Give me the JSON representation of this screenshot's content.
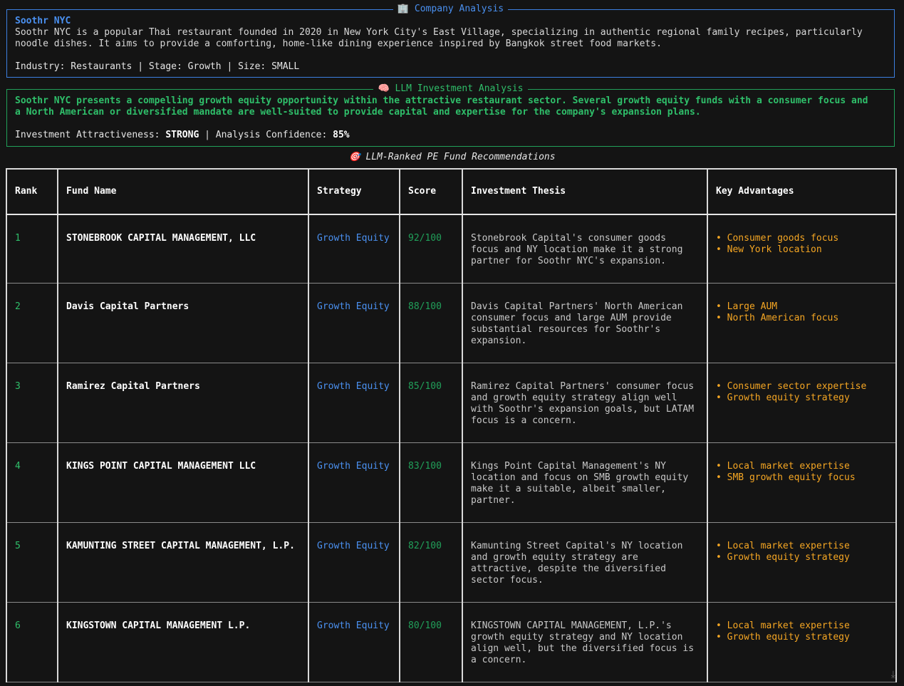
{
  "company_panel": {
    "title": "Company Analysis",
    "title_icon": "building-icon",
    "company_name": "Soothr NYC",
    "description": "Soothr NYC is a popular Thai restaurant founded in 2020 in New York City's East Village, specializing in authentic regional family recipes, particularly\nnoodle dishes. It aims to provide a comforting, home-like dining experience inspired by Bangkok street food markets.",
    "industry_label": "Industry:",
    "industry": "Restaurants",
    "stage_label": "Stage:",
    "stage": "Growth",
    "size_label": "Size:",
    "size": "SMALL",
    "border_color": "#3d7fe0"
  },
  "llm_panel": {
    "title": "LLM Investment Analysis",
    "title_icon": "brain-icon",
    "summary": "Soothr NYC presents a compelling growth equity opportunity within the attractive restaurant sector. Several growth equity funds with a consumer focus and\na North American or diversified mandate are well-suited to provide capital and expertise for the company's expansion plans.",
    "attractiveness_label": "Investment Attractiveness:",
    "attractiveness": "STRONG",
    "confidence_label": "Analysis Confidence:",
    "confidence": "85%",
    "border_color": "#21a05a"
  },
  "rankings": {
    "title": "LLM-Ranked PE Fund Recommendations",
    "title_icon": "target-icon",
    "headers": {
      "rank": "Rank",
      "fund_name": "Fund Name",
      "strategy": "Strategy",
      "score": "Score",
      "thesis": "Investment Thesis",
      "advantages": "Key Advantages"
    },
    "rows": [
      {
        "rank": "1",
        "fund_name": "STONEBROOK CAPITAL MANAGEMENT, LLC",
        "strategy": "Growth Equity",
        "score": "92/100",
        "thesis": "Stonebrook Capital's consumer goods focus and NY location make it a strong partner for Soothr NYC's expansion.",
        "advantages": [
          "• Consumer goods focus",
          "• New York location"
        ]
      },
      {
        "rank": "2",
        "fund_name": "Davis Capital Partners",
        "strategy": "Growth Equity",
        "score": "88/100",
        "thesis": "Davis Capital Partners' North American consumer focus and large AUM provide substantial resources for Soothr's expansion.",
        "advantages": [
          "• Large AUM",
          "• North American focus"
        ]
      },
      {
        "rank": "3",
        "fund_name": "Ramirez Capital Partners",
        "strategy": "Growth Equity",
        "score": "85/100",
        "thesis": "Ramirez Capital Partners' consumer focus and growth equity strategy align well with Soothr's expansion goals, but LATAM focus is a concern.",
        "advantages": [
          "• Consumer sector expertise",
          "• Growth equity strategy"
        ]
      },
      {
        "rank": "4",
        "fund_name": "KINGS POINT CAPITAL MANAGEMENT LLC",
        "strategy": "Growth Equity",
        "score": "83/100",
        "thesis": "Kings Point Capital Management's NY location and focus on SMB growth equity make it a suitable, albeit smaller, partner.",
        "advantages": [
          "• Local market expertise",
          "• SMB growth equity focus"
        ]
      },
      {
        "rank": "5",
        "fund_name": "KAMUNTING STREET CAPITAL MANAGEMENT, L.P.",
        "strategy": "Growth Equity",
        "score": "82/100",
        "thesis": "Kamunting Street Capital's NY location and growth equity strategy are attractive, despite the diversified sector focus.",
        "advantages": [
          "• Local market expertise",
          "• Growth equity strategy"
        ]
      },
      {
        "rank": "6",
        "fund_name": "KINGSTOWN CAPITAL MANAGEMENT L.P.",
        "strategy": "Growth Equity",
        "score": "80/100",
        "thesis": "KINGSTOWN CAPITAL MANAGEMENT, L.P.'s growth equity strategy and NY location align well, but the diversified focus is a concern.",
        "advantages": [
          "• Local market expertise",
          "• Growth equity strategy"
        ]
      }
    ]
  },
  "colors": {
    "background": "#141414",
    "blue": "#4a90f0",
    "green": "#2fbf6a",
    "orange": "#f5a623"
  }
}
